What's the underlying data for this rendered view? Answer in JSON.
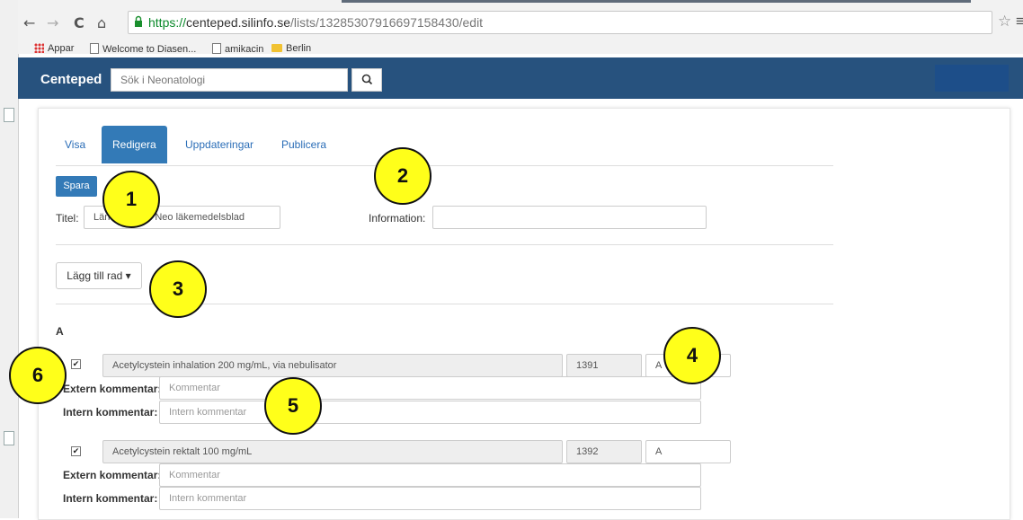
{
  "browser": {
    "url_scheme": "https://",
    "url_host": "centeped.silinfo.se",
    "url_path": "/lists/13285307916697158430/edit",
    "back_symbol": "←",
    "forward_symbol": "→",
    "reload_symbol": "C",
    "home_symbol": "⌂",
    "star_symbol": "☆",
    "menu_symbol": "≡",
    "bookmarks": [
      "Appar",
      "Welcome to Diasen...",
      "amikacin",
      "Berlin"
    ]
  },
  "topbar": {
    "brand": "Centeped",
    "search_placeholder": "Sök i Neonatologi",
    "bg_color": "#27527e"
  },
  "tabs": [
    {
      "label": "Visa",
      "active": false
    },
    {
      "label": "Redigera",
      "active": true
    },
    {
      "label": "Uppdateringar",
      "active": false
    },
    {
      "label": "Publicera",
      "active": false
    }
  ],
  "form": {
    "save_label": "Spara",
    "title_label": "Titel:",
    "title_value_left": "Län",
    "title_value_right": "Neo läkemedelsblad",
    "info_label": "Information:",
    "info_value": "",
    "add_row_label": "Lägg till rad ▾"
  },
  "section": {
    "letter": "A",
    "rows": [
      {
        "checked": "✔",
        "name": "Acetylcystein inhalation 200 mg/mL, via nebulisator",
        "number": "1391",
        "code": "A",
        "extern_label": "Extern kommentar:",
        "extern_placeholder": "Kommentar",
        "intern_label": "Intern kommentar:",
        "intern_placeholder": "Intern kommentar"
      },
      {
        "checked": "✔",
        "name": "Acetylcystein rektalt 100 mg/mL",
        "number": "1392",
        "code": "A",
        "extern_label": "Extern kommentar:",
        "extern_placeholder": "Kommentar",
        "intern_label": "Intern kommentar:",
        "intern_placeholder": "Intern kommentar"
      }
    ]
  },
  "callouts": [
    "1",
    "2",
    "3",
    "4",
    "5",
    "6"
  ]
}
